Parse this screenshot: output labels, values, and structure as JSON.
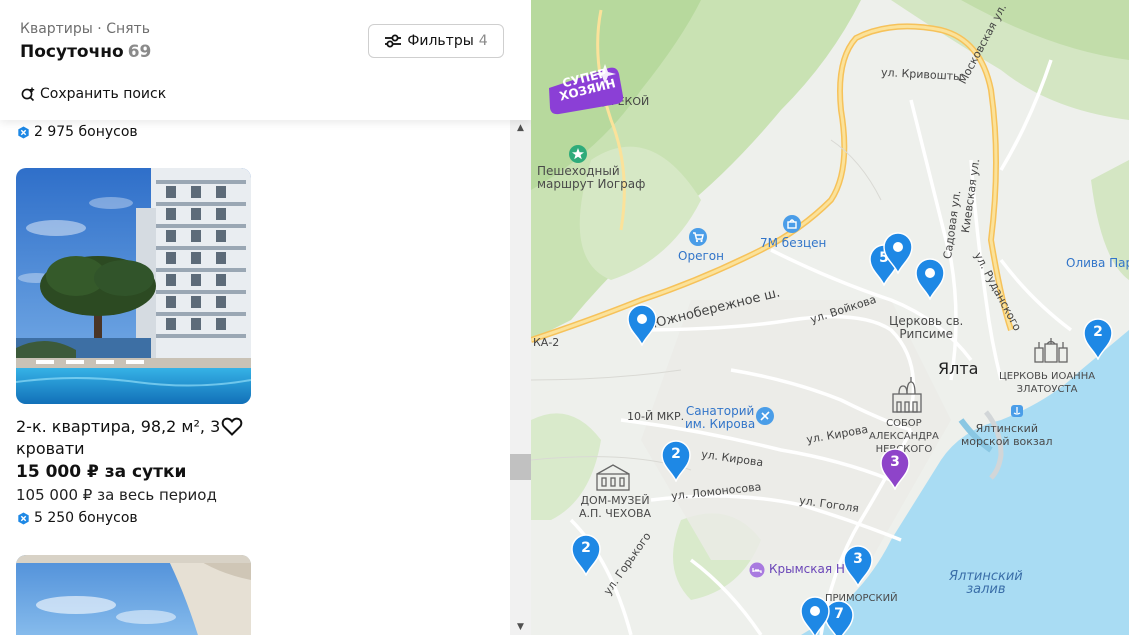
{
  "header": {
    "breadcrumb": "Квартиры · Снять",
    "title": "Посуточно",
    "title_count": "69",
    "filters_label": "Фильтры",
    "filters_count": "4",
    "save_search_label": "Сохранить поиск"
  },
  "listings": [
    {
      "bonus": "2 975 бонусов"
    },
    {
      "title": "2-к. квартира, 98,2 м², 3 кровати",
      "price": "15 000 ₽ за сутки",
      "total": "105 000 ₽ за весь период",
      "bonus": "5 250 бонусов"
    }
  ],
  "map": {
    "badge_line1": "СУПЕР",
    "badge_line2": "ХОЗЯИН",
    "labels": {
      "krivoshty": "ул. Кривошты",
      "derekoy": "ИЙ-ДЕРЕКОЙ",
      "moskovskaya": "Московская ул.",
      "kievskaya": "Киевская ул.",
      "sadovaya": "Садовая ул.",
      "rudanskogo": "ул. Руданского",
      "trail_line1": "Пешеходный",
      "trail_line2": "маршрут Иограф",
      "oregon": "Орегон",
      "bezcen": "7М безцен",
      "oliva": "Олива Пар",
      "yuzhnoberezhnoe": "Южнобережное ш.",
      "ka2": "КА-2",
      "voykova": "ул. Войкова",
      "ripsime_line1": "Церковь св.",
      "ripsime_line2": "Рипсиме",
      "yalta": "Ялта",
      "ioann_line1": "ЦЕРКОВЬ ИОАННА",
      "ioann_line2": "ЗЛАТОУСТА",
      "mkr10": "10-Й МКР.",
      "kirov_san_line1": "Санаторий",
      "kirov_san_line2": "им. Кирова",
      "kirova_street": "ул. Кирова",
      "kirova_street2": "ул. Кирова",
      "sobor_line1": "СОБОР",
      "sobor_line2": "АЛЕКСАНДРА",
      "sobor_line3": "НЕВСКОГО",
      "port_line1": "Ялтинский",
      "port_line2": "морской вокзал",
      "chekhov_line1": "ДОМ-МУЗЕЙ",
      "chekhov_line2": "А.П. ЧЕХОВА",
      "lomonosova": "ул. Ломоносова",
      "gogolya": "ул. Гоголя",
      "gorkogo": "ул. Горького",
      "krymskaya": "Крымская Н",
      "primorsky": "ПРИМОРСКИЙ",
      "bay_line1": "Ялтинский",
      "bay_line2": "залив"
    },
    "pins": [
      {
        "label": "5",
        "color": "#1e88e5"
      },
      {
        "label": "",
        "color": "#1e88e5"
      },
      {
        "label": "2",
        "color": "#1e88e5"
      },
      {
        "label": "",
        "color": "#1e88e5"
      },
      {
        "label": "",
        "color": "#1e88e5"
      },
      {
        "label": "2",
        "color": "#1e88e5"
      },
      {
        "label": "3",
        "color": "#8e44c9"
      },
      {
        "label": "2",
        "color": "#1e88e5"
      },
      {
        "label": "3",
        "color": "#1e88e5"
      },
      {
        "label": "7",
        "color": "#1e88e5"
      },
      {
        "label": "",
        "color": "#1e88e5"
      }
    ]
  }
}
